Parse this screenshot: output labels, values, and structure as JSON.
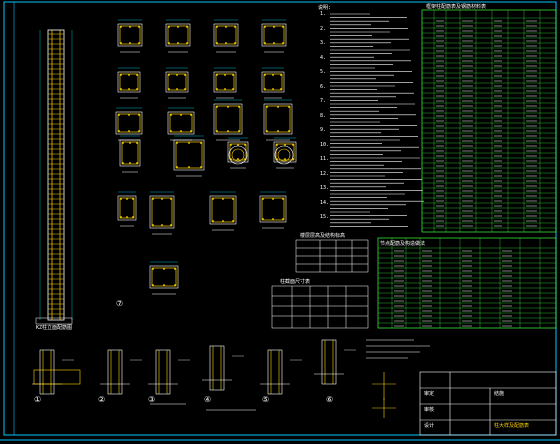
{
  "colors": {
    "background": "#000000",
    "frame": "#00c8ff",
    "rebar": "#ffd400",
    "outline": "#ffffff",
    "table": "#3cff3c",
    "accent": "#ff4dff",
    "dim": "#00e0ff"
  },
  "notes": {
    "title": "说明:",
    "numbers": [
      "1.",
      "2.",
      "3.",
      "4.",
      "5.",
      "6.",
      "7.",
      "8.",
      "9.",
      "10.",
      "11.",
      "12.",
      "13.",
      "14.",
      "15."
    ]
  },
  "table_right_title": "框架柱配筋表及钢筋材料表",
  "table_bottom_title": "节点配筋及构造做法",
  "small_table_1_title": "楼层层高及结构标高",
  "small_table_2_title": "柱截面尺寸表",
  "title_block": {
    "drawing_name": "柱大样及配筋表",
    "sheet_label": "结施",
    "rows": [
      "审定",
      "审核",
      "设计"
    ]
  },
  "detail_markers": [
    "①",
    "②",
    "③",
    "④",
    "⑤",
    "⑥",
    "⑦"
  ],
  "column_left_note": "KZ柱立面配筋图"
}
